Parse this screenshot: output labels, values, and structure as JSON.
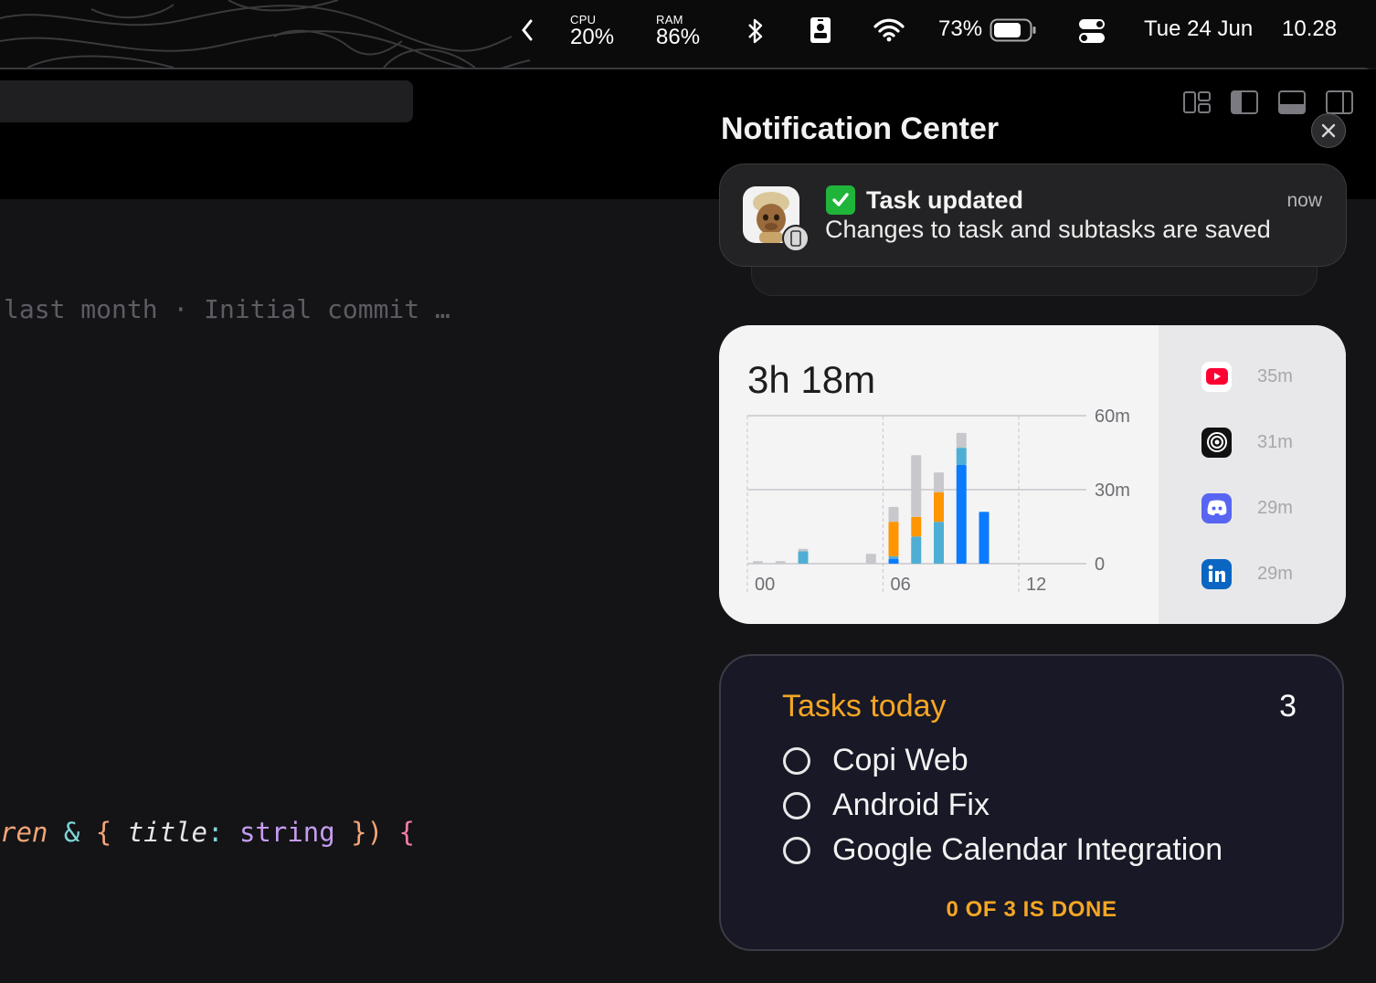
{
  "menubar": {
    "cpu_label": "CPU",
    "cpu_value": "20%",
    "ram_label": "RAM",
    "ram_value": "86%",
    "battery_percent": "73%",
    "date": "Tue 24 Jun",
    "time": "10.28",
    "icons": [
      "chevron-left-icon",
      "bluetooth-icon",
      "badge-icon",
      "wifi-icon",
      "battery-icon",
      "control-center-icon"
    ]
  },
  "editor": {
    "blame": "last month · Initial commit …",
    "code": {
      "t1": "ren",
      "t2": " & ",
      "t3": "{ ",
      "t4": "title",
      "t5": ": ",
      "t6": "string",
      "t7": " })",
      "t8": " {"
    }
  },
  "notification_center": {
    "title": "Notification Center",
    "notification": {
      "title": "Task updated",
      "body": "Changes to task and subtasks are saved",
      "time": "now"
    }
  },
  "screen_time": {
    "total": "3h 18m",
    "apps": [
      {
        "name": "YouTube",
        "icon": "youtube-icon",
        "duration": "35m"
      },
      {
        "name": "ChatGPT",
        "icon": "chatgpt-icon",
        "duration": "31m"
      },
      {
        "name": "Discord",
        "icon": "discord-icon",
        "duration": "29m"
      },
      {
        "name": "LinkedIn",
        "icon": "linkedin-icon",
        "duration": "29m"
      }
    ]
  },
  "chart_data": {
    "type": "bar",
    "stacked": true,
    "x_tick_labels": [
      "00",
      "06",
      "12"
    ],
    "y_tick_labels": [
      "60m",
      "30m",
      "0"
    ],
    "ylim": [
      0,
      60
    ],
    "x_hours": [
      0,
      1,
      2,
      3,
      4,
      5,
      6,
      7,
      8,
      9,
      10,
      11
    ],
    "series": [
      {
        "color": "#0a7bff",
        "values": [
          0,
          0,
          0,
          0,
          0,
          0,
          2,
          0,
          0,
          40,
          21,
          0
        ]
      },
      {
        "color": "#4faed3",
        "values": [
          0,
          0,
          5,
          0,
          0,
          0,
          1,
          11,
          17,
          7,
          0,
          0
        ]
      },
      {
        "color": "#ff9500",
        "values": [
          0,
          0,
          0,
          0,
          0,
          0,
          14,
          8,
          12,
          0,
          0,
          0
        ]
      },
      {
        "color": "#c7c7cc",
        "values": [
          1,
          1,
          1,
          0,
          0,
          4,
          6,
          25,
          8,
          6,
          0,
          0
        ]
      }
    ]
  },
  "tasks": {
    "title": "Tasks today",
    "count": "3",
    "items": [
      "Copi Web",
      "Android Fix",
      "Google Calendar Integration"
    ],
    "footer": "0 OF 3 IS DONE"
  }
}
